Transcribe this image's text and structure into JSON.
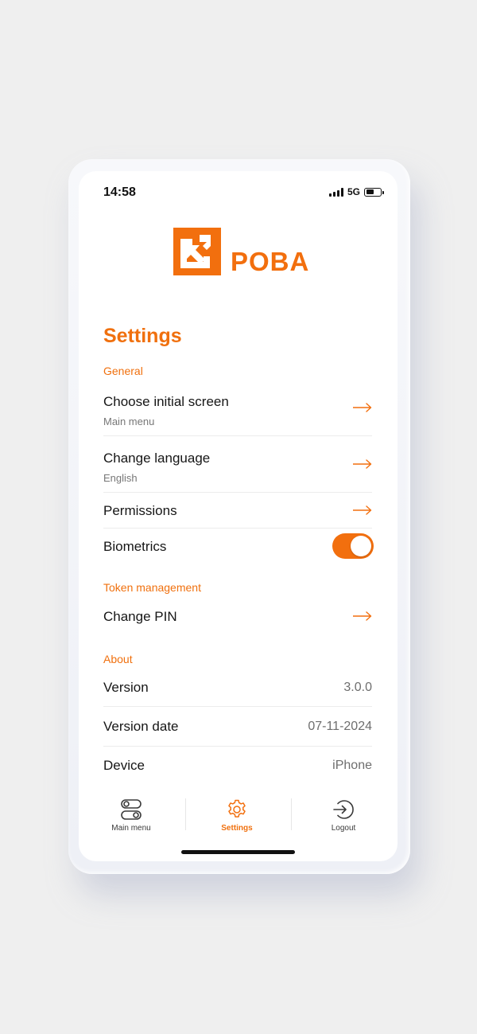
{
  "status_bar": {
    "time": "14:58",
    "network": "5G",
    "battery_level": 0.55
  },
  "logo": {
    "text": "POBA",
    "icon": "poba-logo-icon"
  },
  "page": {
    "title": "Settings"
  },
  "sections": {
    "general": {
      "label": "General",
      "initial_screen": {
        "title": "Choose initial screen",
        "value": "Main menu"
      },
      "language": {
        "title": "Change language",
        "value": "English"
      },
      "permissions": {
        "title": "Permissions"
      },
      "biometrics": {
        "title": "Biometrics",
        "enabled": true
      }
    },
    "token": {
      "label": "Token management",
      "change_pin": {
        "title": "Change PIN"
      }
    },
    "about": {
      "label": "About",
      "version": {
        "title": "Version",
        "value": "3.0.0"
      },
      "version_date": {
        "title": "Version date",
        "value": "07-11-2024"
      },
      "device": {
        "title": "Device",
        "value": "iPhone"
      }
    }
  },
  "tabbar": {
    "items": [
      {
        "label": "Main menu",
        "icon": "toggles-icon",
        "active": false
      },
      {
        "label": "Settings",
        "icon": "gear-icon",
        "active": true
      },
      {
        "label": "Logout",
        "icon": "logout-icon",
        "active": false
      }
    ]
  },
  "colors": {
    "accent": "#f26f0e",
    "text": "#161616",
    "muted": "#777777",
    "background": "#efefef"
  }
}
